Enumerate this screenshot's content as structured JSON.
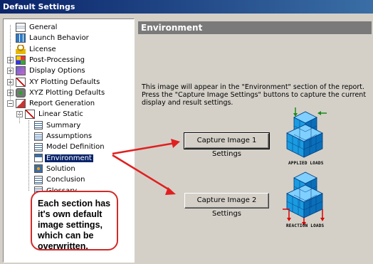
{
  "window": {
    "title": "Default Settings"
  },
  "tree": {
    "items": [
      {
        "label": "General",
        "icon": "doc",
        "expander": ""
      },
      {
        "label": "Launch Behavior",
        "icon": "grid",
        "expander": ""
      },
      {
        "label": "License",
        "icon": "lock",
        "expander": ""
      },
      {
        "label": "Post-Processing",
        "icon": "color",
        "expander": "+"
      },
      {
        "label": "Display Options",
        "icon": "disp",
        "expander": "+"
      },
      {
        "label": "XY Plotting Defaults",
        "icon": "xy",
        "expander": "+"
      },
      {
        "label": "XYZ Plotting Defaults",
        "icon": "xyz",
        "expander": "+"
      },
      {
        "label": "Report Generation",
        "icon": "report",
        "expander": "−"
      },
      {
        "label": "Linear Static",
        "icon": "static",
        "expander": "−"
      },
      {
        "label": "Summary",
        "icon": "small",
        "expander": ""
      },
      {
        "label": "Assumptions",
        "icon": "small",
        "expander": ""
      },
      {
        "label": "Model Definition",
        "icon": "small",
        "expander": ""
      },
      {
        "label": "Environment",
        "icon": "env",
        "expander": "",
        "selected": true
      },
      {
        "label": "Solution",
        "icon": "sol",
        "expander": ""
      },
      {
        "label": "Conclusion",
        "icon": "small",
        "expander": ""
      },
      {
        "label": "Glossary",
        "icon": "small",
        "expander": ""
      }
    ]
  },
  "panel": {
    "header": "Environment",
    "description": "This image will appear in the \"Environment\" section of the report. Press the \"Capture Image Settings\" buttons to capture the current display and result settings.",
    "button1": "Capture Image 1 Settings",
    "button2": "Capture Image 2 Settings",
    "image1_label": "APPLIED LOADS",
    "image2_label": "REACTION LOADS"
  },
  "callout": {
    "text": "Each section has it's own default image settings, which can be overwritten."
  },
  "colors": {
    "accent_red": "#e02020",
    "cube_blue": "#1a9be0",
    "title_blue": "#0a246a"
  }
}
